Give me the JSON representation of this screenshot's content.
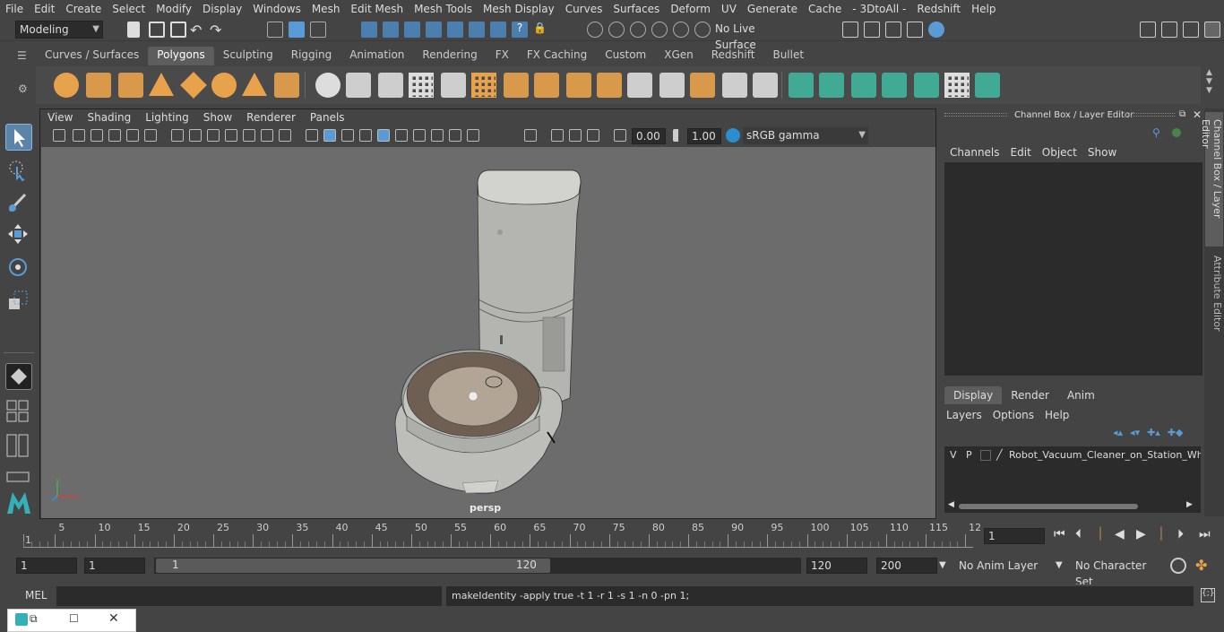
{
  "menus": [
    "File",
    "Edit",
    "Create",
    "Select",
    "Modify",
    "Display",
    "Windows",
    "Mesh",
    "Edit Mesh",
    "Mesh Tools",
    "Mesh Display",
    "Curves",
    "Surfaces",
    "Deform",
    "UV",
    "Generate",
    "Cache",
    "- 3DtoAll -",
    "Redshift",
    "Help"
  ],
  "status": {
    "mode": "Modeling",
    "live_surface": "No Live Surface"
  },
  "shelf": {
    "tabs": [
      "Curves / Surfaces",
      "Polygons",
      "Sculpting",
      "Rigging",
      "Animation",
      "Rendering",
      "FX",
      "FX Caching",
      "Custom",
      "XGen",
      "Redshift",
      "Bullet"
    ],
    "active": "Polygons"
  },
  "viewport": {
    "menus": [
      "View",
      "Shading",
      "Lighting",
      "Show",
      "Renderer",
      "Panels"
    ],
    "exposure": "0.00",
    "gamma": "1.00",
    "colorspace": "sRGB gamma",
    "camera": "persp"
  },
  "channelbox": {
    "title": "Channel Box / Layer Editor",
    "menus": [
      "Channels",
      "Edit",
      "Object",
      "Show"
    ],
    "tabs": [
      "Display",
      "Render",
      "Anim"
    ],
    "layer_menus": [
      "Layers",
      "Options",
      "Help"
    ],
    "layer": {
      "v": "V",
      "p": "P",
      "name": "Robot_Vacuum_Cleaner_on_Station_White"
    }
  },
  "side_tabs": [
    "Channel Box / Layer Editor",
    "Attribute Editor"
  ],
  "timeline": {
    "ticks": [
      "1",
      "5",
      "10",
      "15",
      "20",
      "25",
      "30",
      "35",
      "40",
      "45",
      "50",
      "55",
      "60",
      "65",
      "70",
      "75",
      "80",
      "85",
      "90",
      "95",
      "100",
      "105",
      "110",
      "115",
      "12"
    ],
    "current": "1"
  },
  "range": {
    "start": "1",
    "playstart": "1",
    "slider_start": "1",
    "slider_end": "120",
    "playend": "120",
    "end": "200",
    "anim_layer": "No Anim Layer",
    "char_set": "No Character Set"
  },
  "cmd": {
    "label": "MEL",
    "result": "makeIdentity -apply true -t 1 -r 1 -s 1 -n 0 -pn 1;"
  },
  "colors": {
    "accent": "#5a9bd5",
    "shelf_orange": "#e8a24b",
    "shelf_green": "#3fb59d",
    "viewport_bg": "#6c6c6c"
  }
}
